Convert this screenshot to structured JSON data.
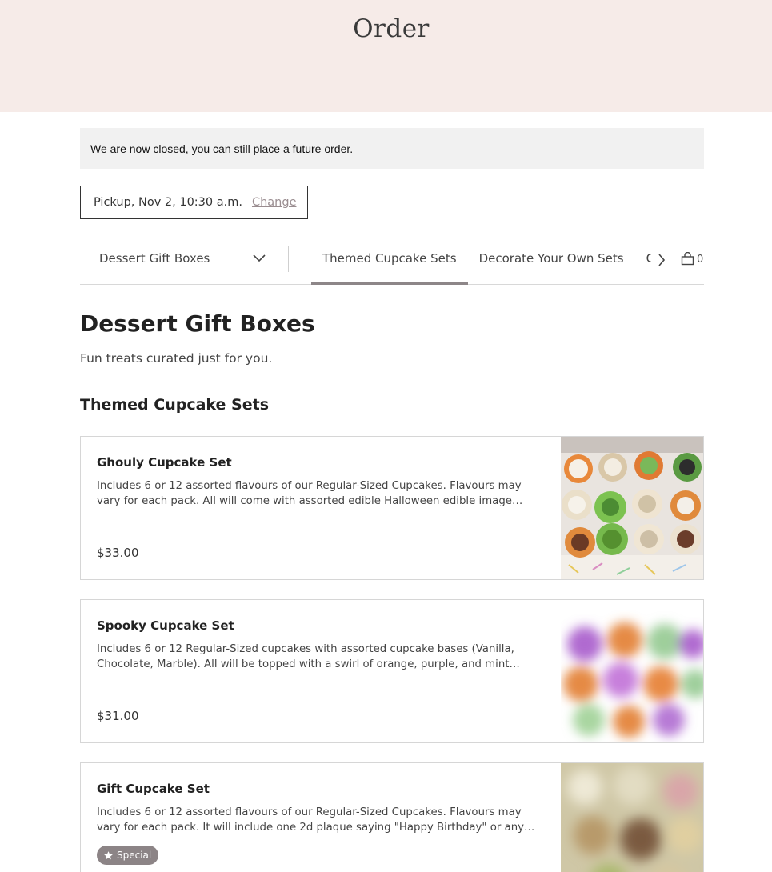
{
  "header": {
    "title": "Order"
  },
  "notice": {
    "text": "We are now closed, you can still place a future order."
  },
  "pickup": {
    "label": "Pickup, Nov 2, 10:30 a.m.",
    "change_label": "Change"
  },
  "category_nav": {
    "selected_category": "Dessert Gift Boxes",
    "tabs": [
      {
        "label": "Themed Cupcake Sets",
        "active": true
      },
      {
        "label": "Decorate Your Own Sets",
        "active": false
      },
      {
        "label": "C",
        "active": false
      }
    ],
    "cart_count": "0"
  },
  "section": {
    "title": "Dessert Gift Boxes",
    "description": "Fun treats curated just for you.",
    "subsection_title": "Themed Cupcake Sets"
  },
  "items": [
    {
      "name": "Ghouly Cupcake Set",
      "description": "Includes 6 or 12 assorted flavours of our Regular-Sized Cupcakes. Flavours may vary for each pack. All will come with assorted edible Halloween edible image toppers.",
      "price": "$33.00"
    },
    {
      "name": "Spooky Cupcake Set",
      "description": "Includes 6 or 12 Regular-Sized cupcakes with assorted cupcake bases (Vanilla, Chocolate, Marble). All will be topped with a swirl of orange, purple, and mint green...",
      "price": "$31.00"
    },
    {
      "name": "Gift Cupcake Set",
      "description": "Includes 6 or 12 assorted flavours of our Regular-Sized Cupcakes. Flavours may vary for each pack. It will include one 2d plaque saying \"Happy Birthday\" or any other...",
      "badge": "Special"
    }
  ],
  "colors": {
    "hero_background": "#f6ebe8",
    "notice_background": "#f1f1f1",
    "link_muted": "#9a8d90",
    "active_tab_underline": "#8d8688",
    "badge_background": "#8c8486"
  },
  "icons": {
    "dropdown": "chevron-down-icon",
    "tabs_scroll": "chevron-right-icon",
    "cart": "shopping-bag-icon",
    "badge": "star-icon"
  }
}
